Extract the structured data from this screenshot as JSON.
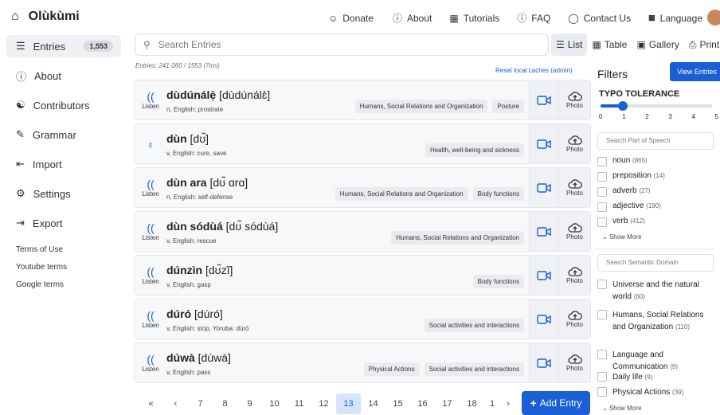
{
  "app": {
    "name": "Olùkùmi"
  },
  "topnav": [
    {
      "label": "Donate",
      "icon": "people-icon"
    },
    {
      "label": "About",
      "icon": "info-icon"
    },
    {
      "label": "Tutorials",
      "icon": "tutorial-icon"
    },
    {
      "label": "FAQ",
      "icon": "question-icon"
    },
    {
      "label": "Contact Us",
      "icon": "chat-icon"
    },
    {
      "label": "Language",
      "icon": "translate-icon"
    }
  ],
  "sidebar": {
    "entries_label": "Entries",
    "entries_count": "1,553",
    "items": [
      {
        "label": "About",
        "icon": "info-icon"
      },
      {
        "label": "Contributors",
        "icon": "contributors-icon"
      },
      {
        "label": "Grammar",
        "icon": "edit-icon"
      },
      {
        "label": "Import",
        "icon": "import-icon"
      },
      {
        "label": "Settings",
        "icon": "gear-icon"
      },
      {
        "label": "Export",
        "icon": "export-icon"
      }
    ],
    "links": [
      "Terms of Use",
      "Youtube terms",
      "Google terms"
    ]
  },
  "search": {
    "placeholder": "Search Entries"
  },
  "view_tabs": [
    {
      "label": "List",
      "icon": "list-icon"
    },
    {
      "label": "Table",
      "icon": "table-icon"
    },
    {
      "label": "Gallery",
      "icon": "gallery-icon"
    },
    {
      "label": "Print",
      "icon": "print-icon"
    }
  ],
  "results_meta": "Entries: 241-260 / 1553 (7ms)",
  "reset_label": "Reset local caches (admin)",
  "listen_label": "Listen",
  "photo_label": "Photo",
  "entries": [
    {
      "headword": "dùdúnálẹ̀",
      "phonetic": "[dùdúnálɛ̀]",
      "gloss": "n, English: prostrate",
      "tags": [
        "Humans, Social Relations and Organization",
        "Posture"
      ],
      "audio": "listen"
    },
    {
      "headword": "dùn",
      "phonetic": "[dʊ̃]",
      "gloss": "v, English: cure, save",
      "tags": [
        "Health, well-being and sickness"
      ],
      "audio": "mic"
    },
    {
      "headword": "dùn ara",
      "phonetic": "[dʊ̃ ɑrɑ]",
      "gloss": "n, English: self-defense",
      "tags": [
        "Humans, Social Relations and Organization",
        "Body functions"
      ],
      "audio": "listen"
    },
    {
      "headword": "dùn sódùá",
      "phonetic": "[dʊ̃ sódùá]",
      "gloss": "v, English: rescue",
      "tags": [
        "Humans, Social Relations and Organization"
      ],
      "audio": "listen"
    },
    {
      "headword": "dúnzìn",
      "phonetic": "[dʊ̃zĩ]",
      "gloss": "v, English: gasp",
      "tags": [
        "Body functions"
      ],
      "audio": "listen"
    },
    {
      "headword": "dúró",
      "phonetic": "[dúró]",
      "gloss": "v, English: stop, Yoruba: dúró",
      "tags": [
        "Social activities and interactions"
      ],
      "audio": "listen"
    },
    {
      "headword": "dúwà",
      "phonetic": "[dúwà]",
      "gloss": "v, English: pass",
      "tags": [
        "Physical Actions",
        "Social activities and interactions"
      ],
      "audio": "listen"
    }
  ],
  "pager": {
    "first": "«",
    "prev": "‹",
    "pages": [
      "7",
      "8",
      "9",
      "10",
      "11",
      "12",
      "13",
      "14",
      "15",
      "16",
      "17",
      "18",
      "1"
    ],
    "current": "13",
    "next": "›",
    "last": "»"
  },
  "add_entry_label": "Add Entry",
  "filters": {
    "title": "Filters",
    "view_entries": "View Entries",
    "typo_tolerance": "TYPO TOLERANCE",
    "typo_value": 1,
    "typo_ticks": [
      "0",
      "1",
      "2",
      "3",
      "4",
      "5"
    ],
    "pos_placeholder": "Search Part of Speech",
    "pos": [
      {
        "label": "noun",
        "count": "(865)"
      },
      {
        "label": "preposition",
        "count": "(14)"
      },
      {
        "label": "adverb",
        "count": "(27)"
      },
      {
        "label": "adjective",
        "count": "(190)"
      },
      {
        "label": "verb",
        "count": "(412)"
      }
    ],
    "show_more": "Show More",
    "domain_placeholder": "Search Semantic Domain",
    "domains": [
      {
        "label": "Universe and the natural world",
        "count": "(60)"
      },
      {
        "label": "Humans, Social Relations and Organization",
        "count": "(110)"
      },
      {
        "label": "Language and Communication",
        "count": "(9)"
      },
      {
        "label": "Daily life",
        "count": "(9)"
      },
      {
        "label": "Physical Actions",
        "count": "(39)"
      }
    ]
  },
  "colors": {
    "accent": "#1a5fd6"
  }
}
